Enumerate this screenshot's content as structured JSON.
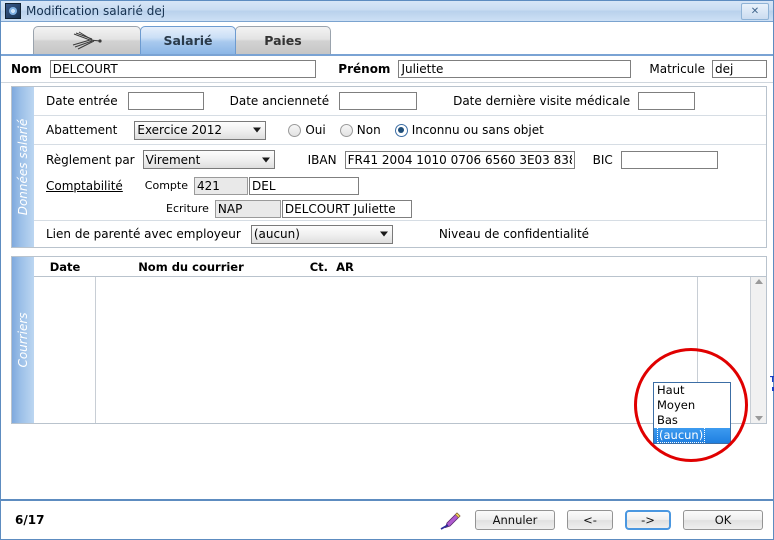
{
  "window": {
    "title": "Modification salarié dej",
    "app_icon": "gear-icon",
    "close_label": "✕"
  },
  "tabs": [
    {
      "id": "tab-signature",
      "label": "",
      "icon": "dragonfly-icon",
      "active": false
    },
    {
      "id": "tab-salarie",
      "label": "Salarié",
      "active": true
    },
    {
      "id": "tab-paies",
      "label": "Paies",
      "active": false
    }
  ],
  "identity": {
    "nom_label": "Nom",
    "nom_value": "DELCOURT",
    "prenom_label": "Prénom",
    "prenom_value": "Juliette",
    "matricule_label": "Matricule",
    "matricule_value": "dej"
  },
  "sections": {
    "donnees_salarie": {
      "vertical_label": "Données salarié",
      "dates": {
        "date_entree_label": "Date entrée",
        "date_entree_value": "",
        "date_anciennete_label": "Date ancienneté",
        "date_anciennete_value": "",
        "date_visite_label": "Date dernière visite médicale",
        "date_visite_value": ""
      },
      "abattement": {
        "label": "Abattement",
        "select_value": "Exercice 2012",
        "radio_oui": "Oui",
        "radio_non": "Non",
        "radio_inconnu": "Inconnu ou sans objet",
        "selected": "Inconnu ou sans objet"
      },
      "reglement": {
        "label": "Règlement par",
        "select_value": "Virement",
        "iban_label": "IBAN",
        "iban_value": "FR41 2004 1010 0706 6560 3E03 838",
        "bic_label": "BIC",
        "bic_value": ""
      },
      "comptabilite": {
        "label": "Comptabilité",
        "compte_label": "Compte",
        "compte_code": "421",
        "compte_name": "DEL",
        "ecriture_label": "Ecriture",
        "ecriture_code": "NAP",
        "ecriture_name": "DELCOURT Juliette"
      },
      "lien_parente": {
        "label": "Lien de parenté avec employeur",
        "select_value": "(aucun)"
      },
      "confidentialite": {
        "label": "Niveau de confidentialité",
        "select_value": "(aucun)",
        "expanded": true,
        "options": [
          "Haut",
          "Moyen",
          "Bas",
          "(aucun)"
        ],
        "highlighted_option": "(aucun)",
        "highlight_color": "#2f8aea",
        "annotation_color": "#e00000"
      }
    },
    "courriers": {
      "vertical_label": "Courriers",
      "columns": [
        "Date",
        "Nom du courrier",
        "Ct.",
        "AR"
      ],
      "rows": [],
      "add_text_icon": "add-text-person-icon"
    }
  },
  "statusbar": {
    "position": "6/17",
    "pencil_icon": "pencil-icon",
    "buttons": [
      {
        "id": "cancel",
        "label": "Annuler",
        "focused": false
      },
      {
        "id": "prev",
        "label": "<-",
        "focused": false
      },
      {
        "id": "next",
        "label": "->",
        "focused": true
      },
      {
        "id": "ok",
        "label": "OK",
        "focused": false
      }
    ]
  }
}
